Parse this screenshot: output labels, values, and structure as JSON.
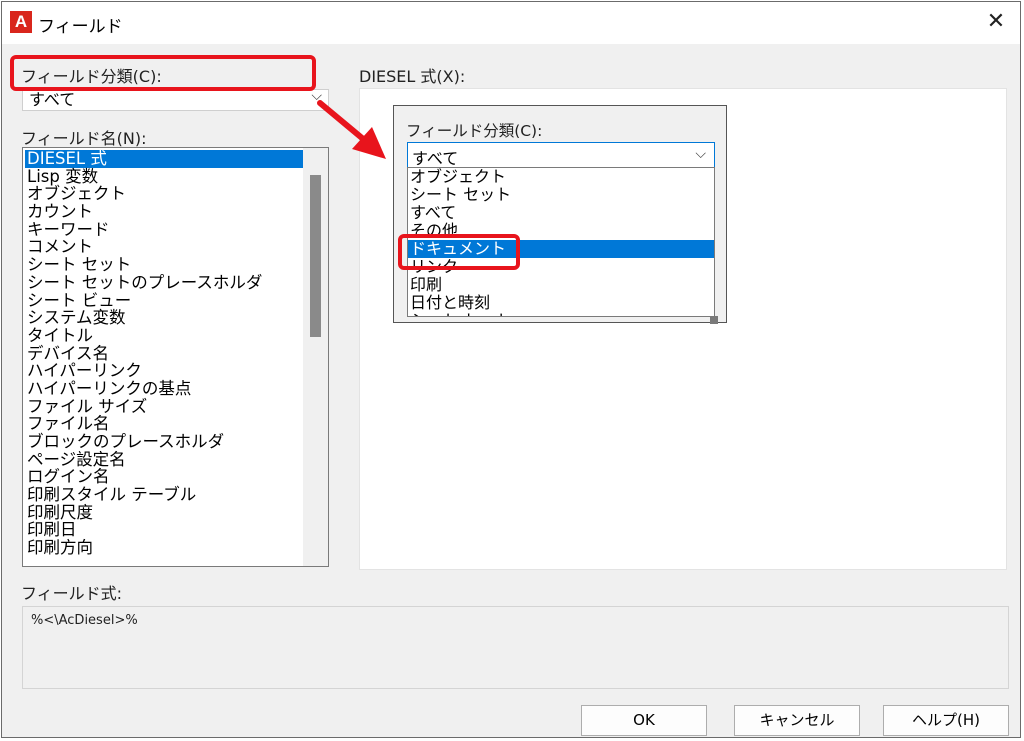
{
  "window": {
    "title": "フィールド",
    "app_icon": "autocad-a-icon",
    "close_icon": "close-icon"
  },
  "left": {
    "category_label": "フィールド分類(C):",
    "category_value": "すべて",
    "field_name_label": "フィールド名(N):",
    "field_names": [
      {
        "label": "DIESEL 式",
        "selected": true
      },
      {
        "label": "Lisp 変数"
      },
      {
        "label": "オブジェクト"
      },
      {
        "label": "カウント"
      },
      {
        "label": "キーワード"
      },
      {
        "label": "コメント"
      },
      {
        "label": "シート セット"
      },
      {
        "label": "シート セットのプレースホルダ"
      },
      {
        "label": "シート ビュー"
      },
      {
        "label": "システム変数"
      },
      {
        "label": "タイトル"
      },
      {
        "label": "デバイス名"
      },
      {
        "label": "ハイパーリンク"
      },
      {
        "label": "ハイパーリンクの基点"
      },
      {
        "label": "ファイル サイズ"
      },
      {
        "label": "ファイル名"
      },
      {
        "label": "ブロックのプレースホルダ"
      },
      {
        "label": "ページ設定名"
      },
      {
        "label": "ログイン名"
      },
      {
        "label": "印刷スタイル テーブル"
      },
      {
        "label": "印刷尺度"
      },
      {
        "label": "印刷日"
      },
      {
        "label": "印刷方向"
      }
    ]
  },
  "right": {
    "diesel_label": "DIESEL 式(X):"
  },
  "bottom": {
    "field_expr_label": "フィールド式:",
    "field_expr_value": "%<\\AcDiesel>%"
  },
  "buttons": {
    "ok": "OK",
    "cancel": "キャンセル",
    "help": "ヘルプ(H)"
  },
  "inset": {
    "label": "フィールド分類(C):",
    "value": "すべて",
    "options": [
      {
        "label": "オブジェクト"
      },
      {
        "label": "シート セット"
      },
      {
        "label": "すべて"
      },
      {
        "label": "その他"
      },
      {
        "label": "ドキュメント",
        "selected": true
      },
      {
        "label": "リンク"
      },
      {
        "label": "印刷"
      },
      {
        "label": "日付と時刻"
      },
      {
        "label": "シート セット"
      }
    ]
  },
  "annotation": {
    "highlight_color": "#e8141c",
    "selection_color": "#0078d7"
  }
}
